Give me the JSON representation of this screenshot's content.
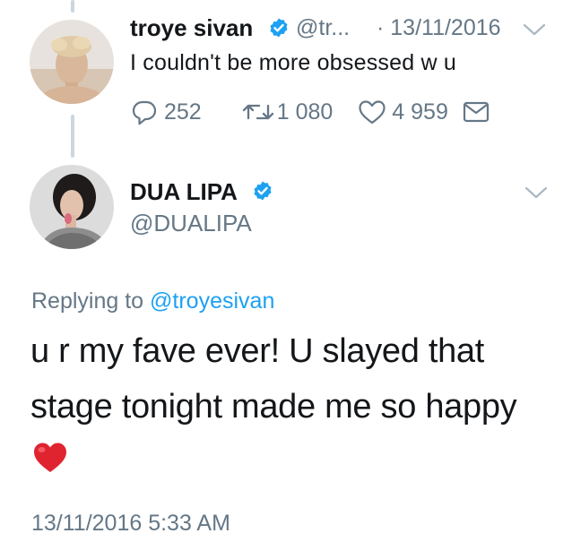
{
  "reply_tweet": {
    "author_name": "troye sivan",
    "author_handle": "@tr...",
    "date": "· 13/11/2016",
    "text": "I couldn't be more obsessed w u",
    "reply_count": "252",
    "retweet_count": "1 080",
    "like_count": "4 959"
  },
  "main_tweet": {
    "author_name": "DUA LIPA",
    "author_handle": "@DUALIPA",
    "replying_label": "Replying to",
    "replying_handle": "@troyesivan",
    "text_line1": "u r my fave ever! U slayed that",
    "text_line2": "stage tonight made me so happy",
    "timestamp": "13/11/2016 5:33 AM"
  },
  "colors": {
    "verified": "#1da1f2",
    "text": "#14171a",
    "secondary": "#657786",
    "link": "#1da1f2",
    "thread_line": "#ccd6dd",
    "heart_emoji": "#e0242f"
  },
  "icons": {
    "verified": "verified-badge-icon",
    "chevron": "chevron-down-icon",
    "reply": "reply-icon",
    "retweet": "retweet-icon",
    "like": "heart-icon",
    "dm": "envelope-icon",
    "emoji": "red-heart-emoji"
  }
}
